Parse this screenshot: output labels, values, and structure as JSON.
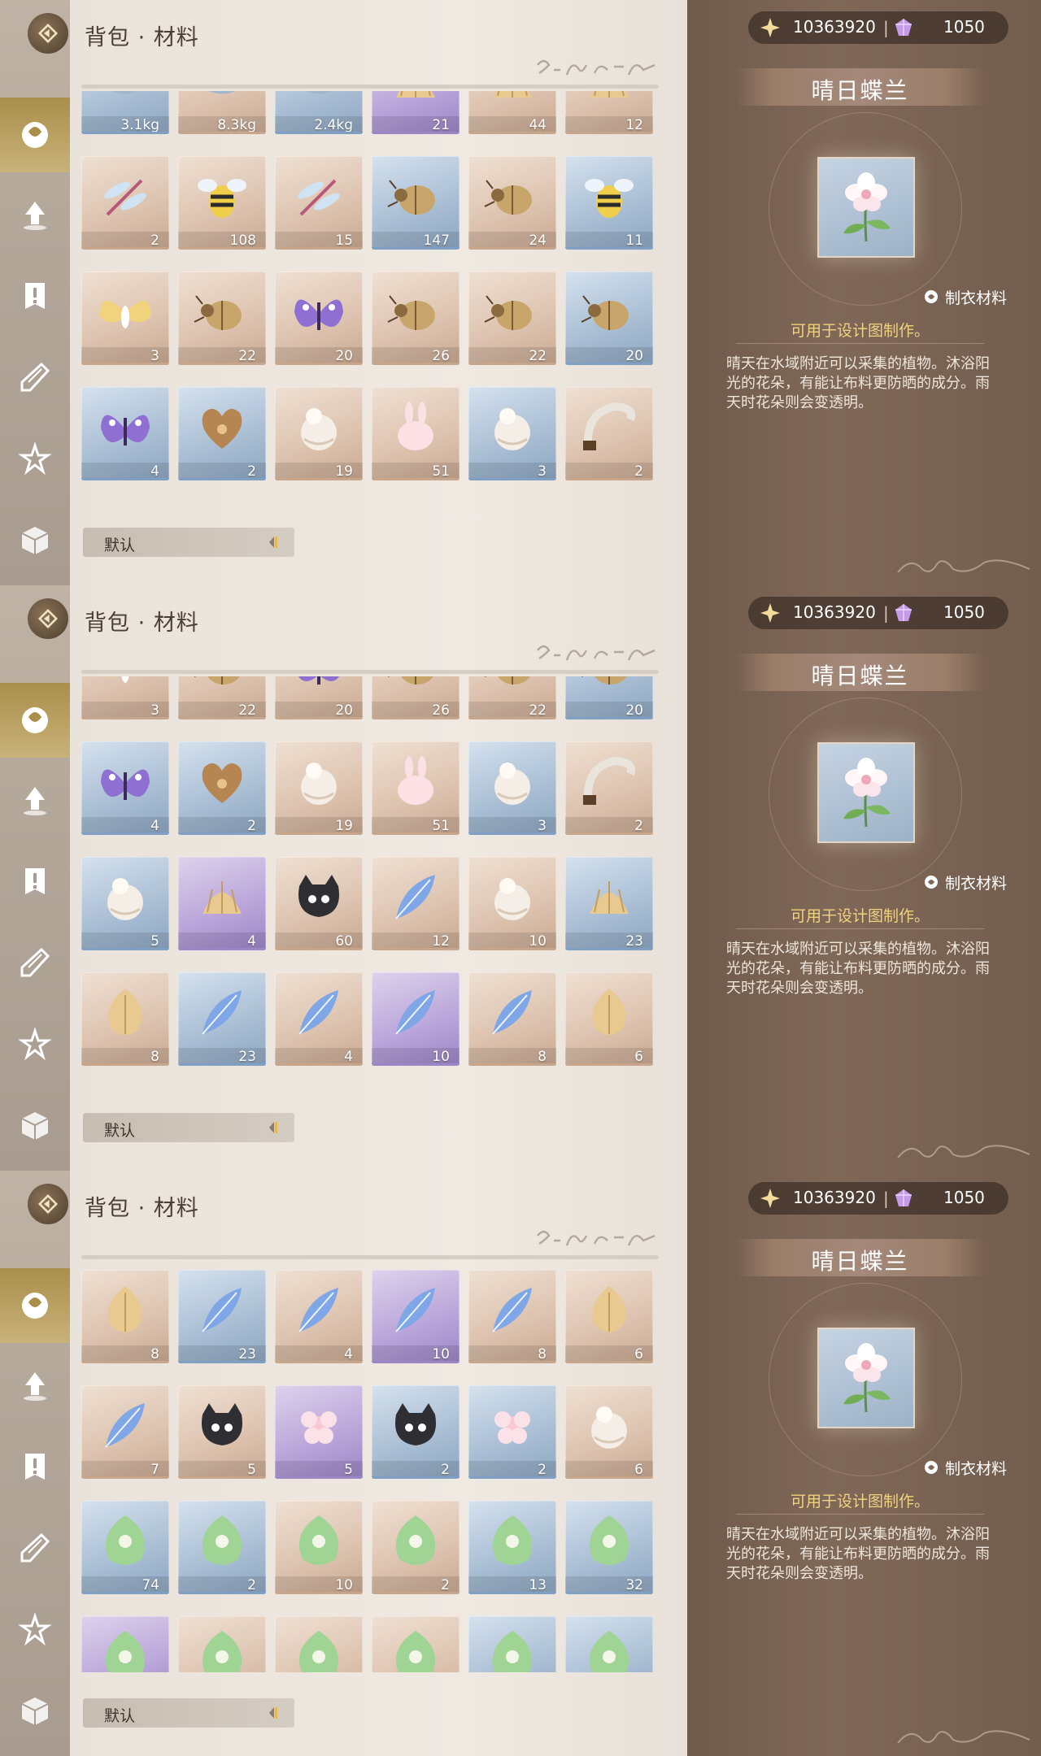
{
  "header": {
    "title": "背包 · 材料"
  },
  "sort": {
    "label": "默认"
  },
  "currency": {
    "gold": "10363920",
    "separator": "|",
    "gems": "1050"
  },
  "item": {
    "name": "晴日蝶兰",
    "tag": "制衣材料",
    "usage": "可用于设计图制作。",
    "description": "晴天在水域附近可以采集的植物。沐浴阳光的花朵，有能让布料更防晒的成分。雨天时花朵则会变透明。"
  },
  "panels": [
    {
      "rows": [
        {
          "offset": -62,
          "items": [
            {
              "t": "blue",
              "n": "3.1kg",
              "i": "fish"
            },
            {
              "t": "tan",
              "n": "8.3kg",
              "i": "fish"
            },
            {
              "t": "blue",
              "n": "2.4kg",
              "i": "fish"
            },
            {
              "t": "purple",
              "n": "21",
              "i": "shell"
            },
            {
              "t": "tan",
              "n": "44",
              "i": "shell"
            },
            {
              "t": "tan",
              "n": "12",
              "i": "shell"
            }
          ]
        },
        {
          "offset": 80,
          "items": [
            {
              "t": "tan",
              "n": "2",
              "i": "dragonfly"
            },
            {
              "t": "tan",
              "n": "108",
              "i": "bee"
            },
            {
              "t": "tan",
              "n": "15",
              "i": "dragonfly"
            },
            {
              "t": "blue",
              "n": "147",
              "i": "beetle"
            },
            {
              "t": "tan",
              "n": "24",
              "i": "beetle"
            },
            {
              "t": "blue",
              "n": "11",
              "i": "bee"
            }
          ]
        },
        {
          "offset": 222,
          "items": [
            {
              "t": "tan",
              "n": "3",
              "i": "moth"
            },
            {
              "t": "tan",
              "n": "22",
              "i": "beetle"
            },
            {
              "t": "tan",
              "n": "20",
              "i": "butterfly"
            },
            {
              "t": "tan",
              "n": "26",
              "i": "beetle"
            },
            {
              "t": "tan",
              "n": "22",
              "i": "beetle"
            },
            {
              "t": "blue",
              "n": "20",
              "i": "beetle"
            }
          ]
        },
        {
          "offset": 364,
          "items": [
            {
              "t": "blue",
              "n": "4",
              "i": "butterfly"
            },
            {
              "t": "blue",
              "n": "2",
              "i": "heart"
            },
            {
              "t": "tan",
              "n": "19",
              "i": "fluff"
            },
            {
              "t": "tan",
              "n": "51",
              "i": "bunny"
            },
            {
              "t": "blue",
              "n": "3",
              "i": "fluff"
            },
            {
              "t": "tan",
              "n": "2",
              "i": "horn"
            }
          ]
        },
        {
          "offset": 506,
          "items": [
            {
              "t": "blue",
              "n": "",
              "i": ""
            },
            {
              "t": "purple",
              "n": "",
              "i": ""
            },
            {
              "t": "tan",
              "n": "",
              "i": ""
            },
            {
              "t": "tan",
              "n": "",
              "i": ""
            },
            {
              "t": "blue",
              "n": "",
              "i": ""
            },
            {
              "t": "blue",
              "n": "",
              "i": ""
            }
          ]
        }
      ]
    },
    {
      "rows": [
        {
          "offset": -62,
          "items": [
            {
              "t": "tan",
              "n": "3",
              "i": "moth"
            },
            {
              "t": "tan",
              "n": "22",
              "i": "beetle"
            },
            {
              "t": "tan",
              "n": "20",
              "i": "butterfly"
            },
            {
              "t": "tan",
              "n": "26",
              "i": "beetle"
            },
            {
              "t": "tan",
              "n": "22",
              "i": "beetle"
            },
            {
              "t": "blue",
              "n": "20",
              "i": "beetle"
            }
          ]
        },
        {
          "offset": 80,
          "items": [
            {
              "t": "blue",
              "n": "4",
              "i": "butterfly"
            },
            {
              "t": "blue",
              "n": "2",
              "i": "heart"
            },
            {
              "t": "tan",
              "n": "19",
              "i": "fluff"
            },
            {
              "t": "tan",
              "n": "51",
              "i": "bunny"
            },
            {
              "t": "blue",
              "n": "3",
              "i": "fluff"
            },
            {
              "t": "tan",
              "n": "2",
              "i": "horn"
            }
          ]
        },
        {
          "offset": 222,
          "items": [
            {
              "t": "blue",
              "n": "5",
              "i": "fluff"
            },
            {
              "t": "purple",
              "n": "4",
              "i": "shell"
            },
            {
              "t": "tan",
              "n": "60",
              "i": "cat"
            },
            {
              "t": "tan",
              "n": "12",
              "i": "feather"
            },
            {
              "t": "tan",
              "n": "10",
              "i": "fluff"
            },
            {
              "t": "blue",
              "n": "23",
              "i": "shell"
            }
          ]
        },
        {
          "offset": 364,
          "items": [
            {
              "t": "tan",
              "n": "8",
              "i": "leaf"
            },
            {
              "t": "blue",
              "n": "23",
              "i": "feather"
            },
            {
              "t": "tan",
              "n": "4",
              "i": "feather"
            },
            {
              "t": "purple",
              "n": "10",
              "i": "feather"
            },
            {
              "t": "tan",
              "n": "8",
              "i": "feather"
            },
            {
              "t": "tan",
              "n": "6",
              "i": "leaf"
            }
          ]
        },
        {
          "offset": 506,
          "items": [
            {
              "t": "tan",
              "n": "",
              "i": ""
            },
            {
              "t": "tan",
              "n": "",
              "i": ""
            },
            {
              "t": "purple",
              "n": "",
              "i": ""
            },
            {
              "t": "blue",
              "n": "",
              "i": ""
            },
            {
              "t": "blue",
              "n": "",
              "i": ""
            },
            {
              "t": "tan",
              "n": "",
              "i": ""
            }
          ]
        }
      ]
    },
    {
      "rows": [
        {
          "offset": 10,
          "items": [
            {
              "t": "tan",
              "n": "8",
              "i": "leaf"
            },
            {
              "t": "blue",
              "n": "23",
              "i": "feather"
            },
            {
              "t": "tan",
              "n": "4",
              "i": "feather"
            },
            {
              "t": "purple",
              "n": "10",
              "i": "feather"
            },
            {
              "t": "tan",
              "n": "8",
              "i": "feather"
            },
            {
              "t": "tan",
              "n": "6",
              "i": "leaf"
            }
          ]
        },
        {
          "offset": 152,
          "items": [
            {
              "t": "tan",
              "n": "7",
              "i": "feather"
            },
            {
              "t": "tan",
              "n": "5",
              "i": "cat"
            },
            {
              "t": "purple",
              "n": "5",
              "i": "flower"
            },
            {
              "t": "blue",
              "n": "2",
              "i": "cat"
            },
            {
              "t": "blue",
              "n": "2",
              "i": "flower"
            },
            {
              "t": "tan",
              "n": "6",
              "i": "fluff"
            }
          ]
        },
        {
          "offset": 294,
          "items": [
            {
              "t": "blue",
              "n": "74",
              "i": "plant"
            },
            {
              "t": "blue",
              "n": "2",
              "i": "plant"
            },
            {
              "t": "tan",
              "n": "10",
              "i": "plant"
            },
            {
              "t": "tan",
              "n": "2",
              "i": "plant"
            },
            {
              "t": "blue",
              "n": "13",
              "i": "plant"
            },
            {
              "t": "blue",
              "n": "32",
              "i": "plant"
            }
          ]
        },
        {
          "offset": 436,
          "items": [
            {
              "t": "purple",
              "n": "",
              "i": "plant"
            },
            {
              "t": "tan",
              "n": "",
              "i": "plant"
            },
            {
              "t": "tan",
              "n": "",
              "i": "plant"
            },
            {
              "t": "tan",
              "n": "",
              "i": "plant"
            },
            {
              "t": "blue",
              "n": "",
              "i": "plant"
            },
            {
              "t": "blue",
              "n": "",
              "i": "plant"
            }
          ]
        }
      ]
    }
  ]
}
